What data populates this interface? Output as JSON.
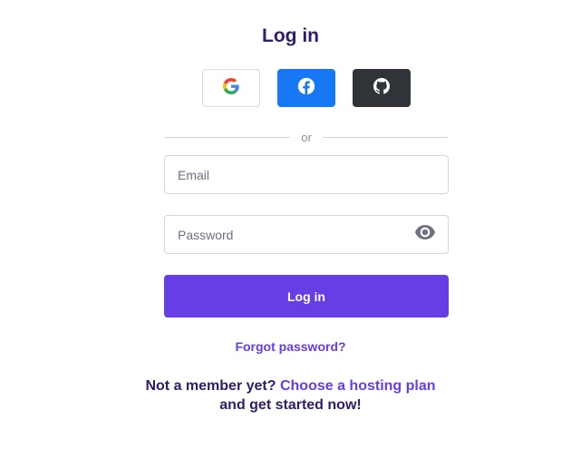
{
  "title": "Log in",
  "social": [
    {
      "provider": "google",
      "icon": "google-icon"
    },
    {
      "provider": "facebook",
      "icon": "facebook-icon",
      "color": "#1877f2"
    },
    {
      "provider": "github",
      "icon": "github-icon",
      "color": "#2f3439"
    }
  ],
  "divider_text": "or",
  "form": {
    "email_placeholder": "Email",
    "email_value": "",
    "password_placeholder": "Password",
    "password_value": "",
    "password_toggle_icon": "eye-icon",
    "submit_label": "Log in"
  },
  "forgot_password": "Forgot password?",
  "signup": {
    "prefix": "Not a member yet?",
    "link": "Choose a hosting plan",
    "suffix": "and get started now!"
  },
  "colors": {
    "accent": "#673de6",
    "title": "#2f1c6a",
    "facebook": "#1877f2",
    "github": "#2f3439"
  }
}
